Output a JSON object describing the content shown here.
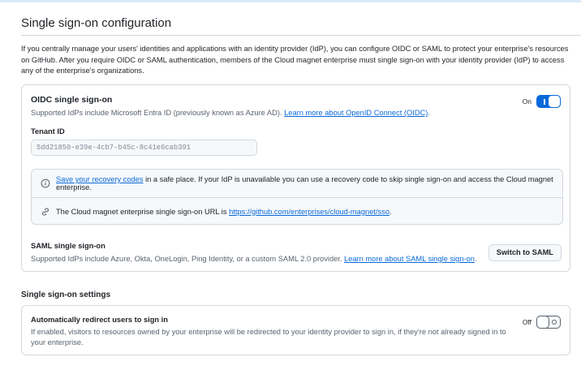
{
  "page": {
    "title": "Single sign-on configuration",
    "intro": "If you centrally manage your users' identities and applications with an identity provider (IdP), you can configure OIDC or SAML to protect your enterprise's resources on GitHub. After you require OIDC or SAML authentication, members of the Cloud magnet enterprise must single sign-on with your identity provider (IdP) to access any of the enterprise's organizations."
  },
  "oidc": {
    "title": "OIDC single sign-on",
    "desc": "Supported IdPs include Microsoft Entra ID (previously known as Azure AD). ",
    "learn_more": "Learn more about OpenID Connect (OIDC)",
    "desc_end": ".",
    "toggle_label": "On",
    "toggle_state": "on",
    "tenant_label": "Tenant ID",
    "tenant_value": "5dd21850-e39e-4cb7-b45c-8c41e6cab391"
  },
  "notice": {
    "recovery_link": "Save your recovery codes",
    "recovery_text": " in a safe place. If your IdP is unavailable you can use a recovery code to skip single sign-on and access the Cloud magnet enterprise.",
    "url_prefix": "The Cloud magnet enterprise single sign-on URL is ",
    "url": "https://github.com/enterprises/cloud-magnet/sso",
    "url_suffix": "."
  },
  "saml": {
    "title": "SAML single sign-on",
    "desc": "Supported IdPs include Azure, Okta, OneLogin, Ping Identity, or a custom SAML 2.0 provider. ",
    "learn_more": "Learn more about SAML single sign-on",
    "desc_end": ".",
    "button": "Switch to SAML"
  },
  "settings": {
    "title": "Single sign-on settings",
    "redirect_title": "Automatically redirect users to sign in",
    "redirect_desc": "If enabled, visitors to resources owned by your enterprise will be redirected to your identity provider to sign in, if they're not already signed in to your enterprise.",
    "toggle_label": "Off",
    "toggle_state": "off"
  },
  "icons": {
    "info": "info-icon",
    "link": "link-icon"
  },
  "colors": {
    "accent": "#0969da",
    "border": "#d1d9e0",
    "muted": "#59636e"
  }
}
